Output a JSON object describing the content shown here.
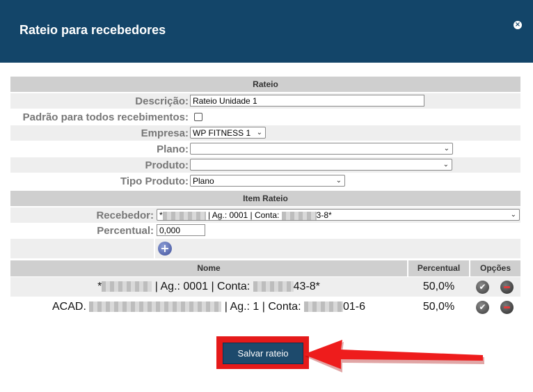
{
  "dialog": {
    "title": "Rateio para recebedores",
    "close_icon": "×"
  },
  "sections": {
    "rateio": "Rateio",
    "item_rateio": "Item Rateio"
  },
  "form": {
    "descricao_label": "Descrição:",
    "descricao_value": "Rateio Unidade 1",
    "padrao_label": "Padrão para todos recebimentos:",
    "empresa_label": "Empresa:",
    "empresa_value": "WP FITNESS 1",
    "plano_label": "Plano:",
    "plano_value": "",
    "produto_label": "Produto:",
    "produto_value": "",
    "tipo_produto_label": "Tipo Produto:",
    "tipo_produto_value": "Plano"
  },
  "item": {
    "recebedor_label": "Recebedor:",
    "recebedor_prefix": "*",
    "recebedor_mid": "| Ag.: 0001 | Conta:",
    "recebedor_suffix": "3-8*",
    "percentual_label": "Percentual:",
    "percentual_value": "0,000"
  },
  "table": {
    "headers": {
      "nome": "Nome",
      "percentual": "Percentual",
      "opcoes": "Opções"
    },
    "rows": [
      {
        "nome_prefix": "*",
        "nome_mid": "| Ag.: 0001 | Conta:",
        "nome_suffix": "43-8*",
        "percentual": "50,0%"
      },
      {
        "nome_prefix": "ACAD.",
        "nome_mid": "| Ag.: 1 | Conta:",
        "nome_suffix": "01-6",
        "percentual": "50,0%"
      }
    ]
  },
  "actions": {
    "save_label": "Salvar rateio"
  },
  "colors": {
    "header_bg": "#134569",
    "highlight": "#e51a1a",
    "button_bg": "#1d4a6c"
  }
}
